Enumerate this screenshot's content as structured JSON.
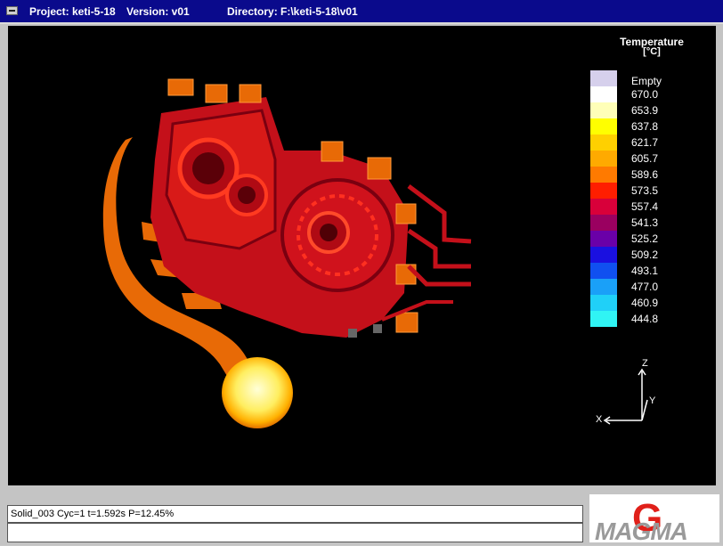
{
  "titlebar": {
    "project": "Project: keti-5-18",
    "version": "Version: v01",
    "directory": "Directory: F:\\keti-5-18\\v01"
  },
  "legend": {
    "title": "Temperature",
    "unit": "[°C]",
    "entries": [
      {
        "label": "Empty",
        "color": "#d6d0ec"
      },
      {
        "label": "670.0",
        "color": "#ffffff"
      },
      {
        "label": "653.9",
        "color": "#ffffb8"
      },
      {
        "label": "637.8",
        "color": "#ffff00"
      },
      {
        "label": "621.7",
        "color": "#ffd000"
      },
      {
        "label": "605.7",
        "color": "#ffaa00"
      },
      {
        "label": "589.6",
        "color": "#ff7a00"
      },
      {
        "label": "573.5",
        "color": "#ff1e00"
      },
      {
        "label": "557.4",
        "color": "#d8003a"
      },
      {
        "label": "541.3",
        "color": "#9a0060"
      },
      {
        "label": "525.2",
        "color": "#6a00a8"
      },
      {
        "label": "509.2",
        "color": "#1a10e0"
      },
      {
        "label": "493.1",
        "color": "#1050f0"
      },
      {
        "label": "477.0",
        "color": "#1aa0f8"
      },
      {
        "label": "460.9",
        "color": "#20d0f8"
      },
      {
        "label": "444.8",
        "color": "#30f4f4"
      }
    ]
  },
  "axes": {
    "z": "Z",
    "y": "Y",
    "x": "X"
  },
  "status": {
    "line1": "Solid_003 Cyc=1 t=1.592s P=12.45%",
    "line2": ""
  },
  "logo": {
    "text": "MAGMA"
  }
}
